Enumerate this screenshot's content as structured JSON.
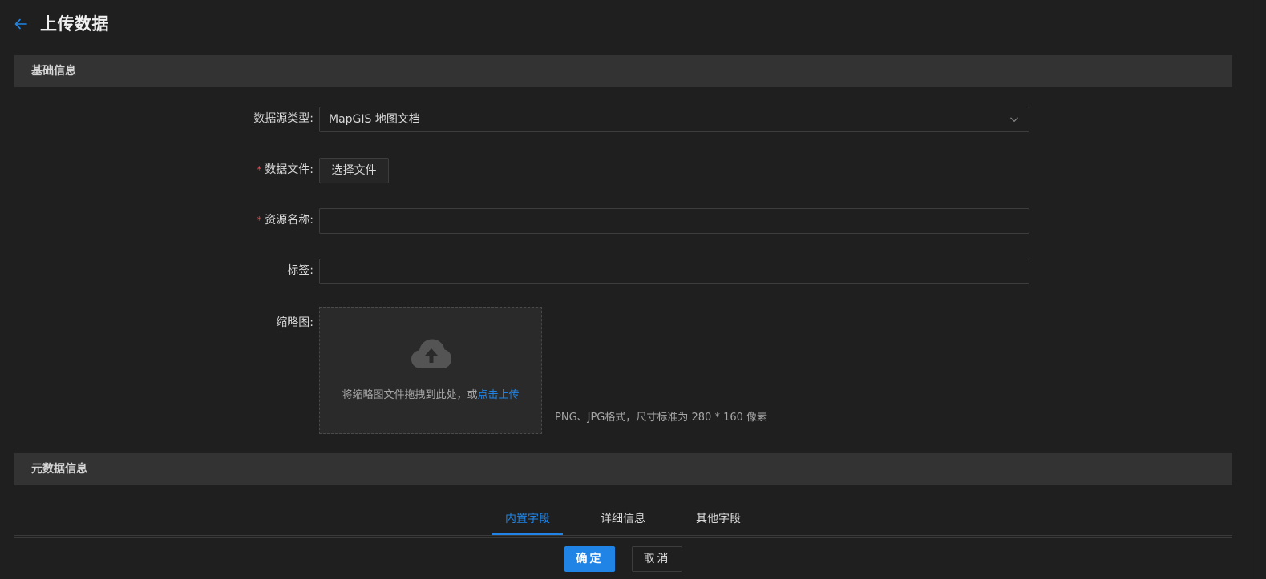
{
  "header": {
    "title": "上传数据"
  },
  "sections": {
    "basic_title": "基础信息",
    "meta_title": "元数据信息"
  },
  "form": {
    "source_type_label": "数据源类型:",
    "source_type_value": "MapGIS 地图文档",
    "data_file_label": "数据文件:",
    "data_file_button": "选择文件",
    "resource_name_label": "资源名称:",
    "resource_name_value": "",
    "tags_label": "标签:",
    "tags_value": "",
    "thumbnail_label": "缩略图:",
    "required_mark": "*"
  },
  "upload": {
    "drag_text": "将缩略图文件拖拽到此处，或",
    "link_text": "点击上传",
    "hint": "PNG、JPG格式，尺寸标准为 280 * 160 像素"
  },
  "tabs": [
    {
      "label": "内置字段",
      "active": true
    },
    {
      "label": "详细信息",
      "active": false
    },
    {
      "label": "其他字段",
      "active": false
    }
  ],
  "footer": {
    "confirm_label": "确定",
    "cancel_label": "取消"
  },
  "colors": {
    "accent": "#1f84e6",
    "background": "#1f1f1f",
    "section_bar": "#333333",
    "required": "#e5484d"
  }
}
